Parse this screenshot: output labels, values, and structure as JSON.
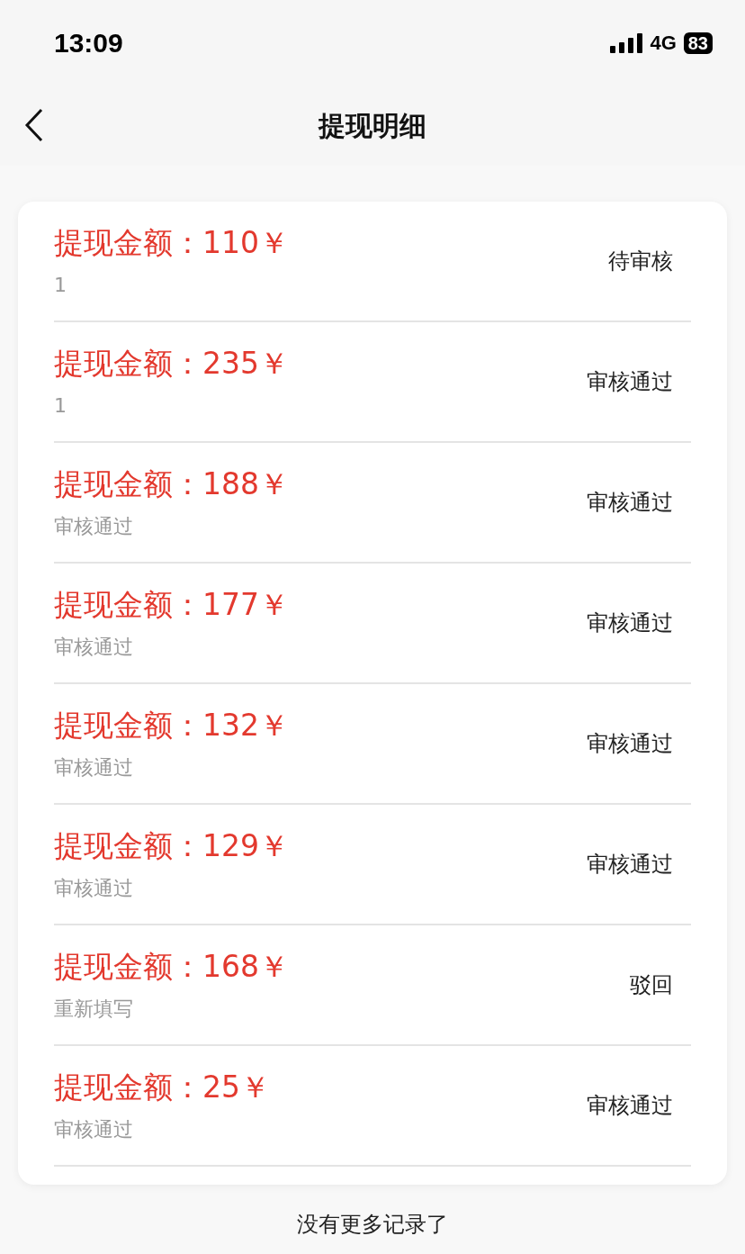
{
  "status_bar": {
    "time": "13:09",
    "network": "4G",
    "battery": "83"
  },
  "nav": {
    "title": "提现明细"
  },
  "records": [
    {
      "amount_label": "提现金额：",
      "amount": "110￥",
      "note": "1",
      "status": "待审核"
    },
    {
      "amount_label": "提现金额：",
      "amount": "235￥",
      "note": "1",
      "status": "审核通过"
    },
    {
      "amount_label": "提现金额：",
      "amount": "188￥",
      "note": "审核通过",
      "status": "审核通过"
    },
    {
      "amount_label": "提现金额：",
      "amount": "177￥",
      "note": "审核通过",
      "status": "审核通过"
    },
    {
      "amount_label": "提现金额：",
      "amount": "132￥",
      "note": "审核通过",
      "status": "审核通过"
    },
    {
      "amount_label": "提现金额：",
      "amount": "129￥",
      "note": "审核通过",
      "status": "审核通过"
    },
    {
      "amount_label": "提现金额：",
      "amount": "168￥",
      "note": "重新填写",
      "status": "驳回"
    },
    {
      "amount_label": "提现金额：",
      "amount": "25￥",
      "note": "审核通过",
      "status": "审核通过"
    }
  ],
  "footer": "没有更多记录了"
}
